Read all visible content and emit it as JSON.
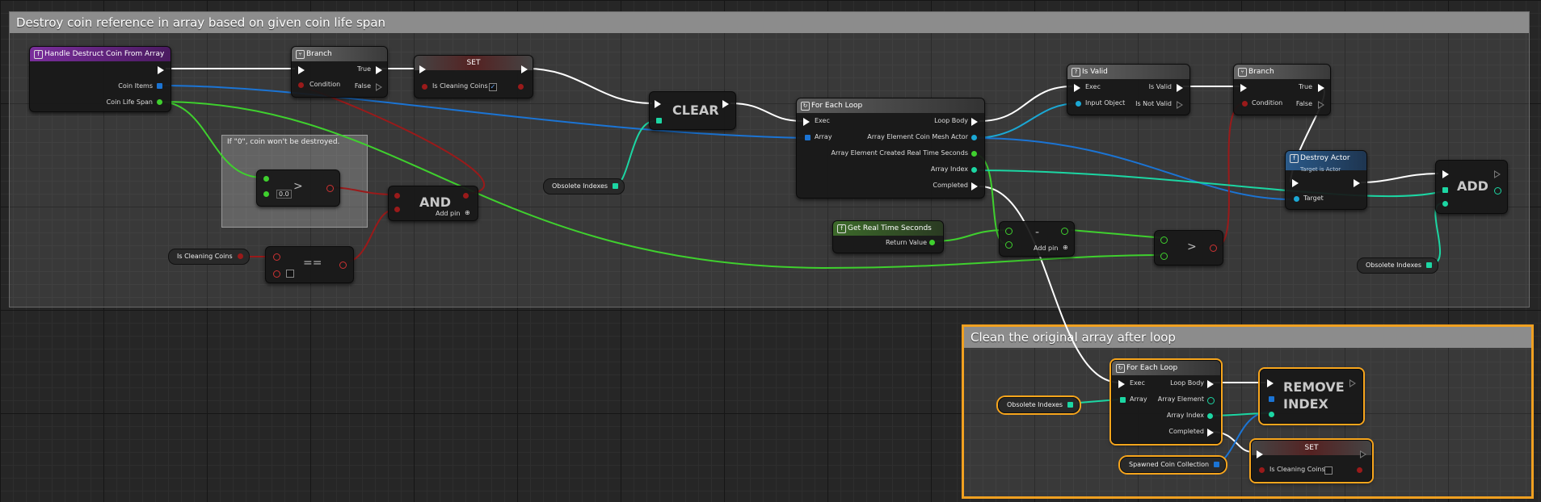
{
  "colors": {
    "exec": "#ffffff",
    "object": "#1b74d4",
    "float": "#3fd02e",
    "bool": "#9a1a1a",
    "int": "#1cd6a3",
    "function": "#6b2a8c",
    "flow": "#5c5c5c",
    "pure": "#3a5a2a",
    "select": "#f7a51c"
  },
  "comments": [
    {
      "title": "Destroy coin reference in array based on given coin life span"
    },
    {
      "title": "Clean the original array after loop"
    },
    {
      "title": "If \"0\", coin won't be destroyed."
    }
  ],
  "nodes": {
    "handle_destruct": {
      "title": "Handle Destruct Coin From Array",
      "pins": [
        "Coin Items",
        "Coin Life Span"
      ]
    },
    "branch1": {
      "title": "Branch",
      "pins": [
        "True",
        "Condition",
        "False"
      ]
    },
    "set1": {
      "title": "SET",
      "pins": [
        "Is Cleaning Coins"
      ]
    },
    "clear": {
      "label": "CLEAR"
    },
    "greater1": {
      "op": ">",
      "value": "0.0"
    },
    "and": {
      "label": "AND",
      "addpin": "Add pin"
    },
    "equal": {
      "op": "=="
    },
    "var_is_cleaning": {
      "label": "Is Cleaning Coins"
    },
    "var_obsolete1": {
      "label": "Obsolete Indexes"
    },
    "foreach1": {
      "title": "For Each Loop",
      "pins": [
        "Exec",
        "Loop Body",
        "Array",
        "Array Element Coin Mesh Actor",
        "Array Element Created Real Time Seconds",
        "Array Index",
        "Completed"
      ]
    },
    "get_real_time": {
      "title": "Get Real Time Seconds",
      "pins": [
        "Return Value"
      ]
    },
    "subtract": {
      "op": "-",
      "addpin": "Add pin"
    },
    "greater2": {
      "op": ">"
    },
    "is_valid": {
      "title": "Is Valid",
      "pins": [
        "Exec",
        "Is Valid",
        "Input Object",
        "Is Not Valid"
      ]
    },
    "branch2": {
      "title": "Branch",
      "pins": [
        "True",
        "Condition",
        "False"
      ]
    },
    "destroy_actor": {
      "title": "Destroy Actor",
      "subtitle": "Target is Actor",
      "pins": [
        "Target"
      ]
    },
    "add": {
      "label": "ADD"
    },
    "var_obsolete2": {
      "label": "Obsolete Indexes"
    },
    "var_obsolete3": {
      "label": "Obsolete Indexes"
    },
    "foreach2": {
      "title": "For Each Loop",
      "pins": [
        "Exec",
        "Loop Body",
        "Array",
        "Array Element",
        "Array Index",
        "Completed"
      ]
    },
    "remove_index": {
      "line1": "REMOVE",
      "line2": "INDEX"
    },
    "var_spawned": {
      "label": "Spawned Coin Collection"
    },
    "set2": {
      "title": "SET",
      "pins": [
        "Is Cleaning Coins"
      ]
    }
  }
}
